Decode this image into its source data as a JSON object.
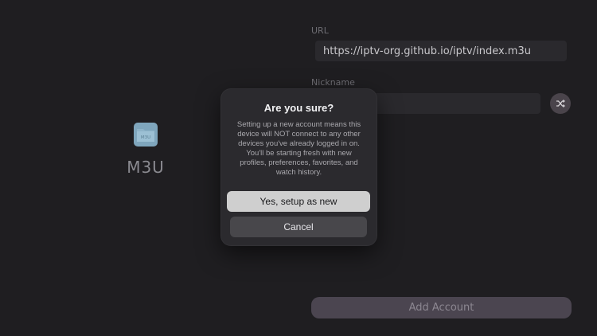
{
  "brand": {
    "icon": "m3u-file-icon",
    "icon_text": "M3U",
    "title": "M3U"
  },
  "form": {
    "url_label": "URL",
    "url_value": "https://iptv-org.github.io/iptv/index.m3u",
    "nickname_label": "Nickname",
    "nickname_value": "",
    "shuffle_icon": "shuffle-icon",
    "add_account_label": "Add Account"
  },
  "dialog": {
    "title": "Are you sure?",
    "body": "Setting up a new account means this device will NOT connect to any other devices you've already logged in on. You'll be starting fresh with new profiles, preferences, favorites, and watch history.",
    "confirm_label": "Yes, setup as new",
    "cancel_label": "Cancel"
  },
  "colors": {
    "background": "#1f1e21",
    "accent": "#4b4550",
    "primary_button": "#cfcfcf"
  }
}
